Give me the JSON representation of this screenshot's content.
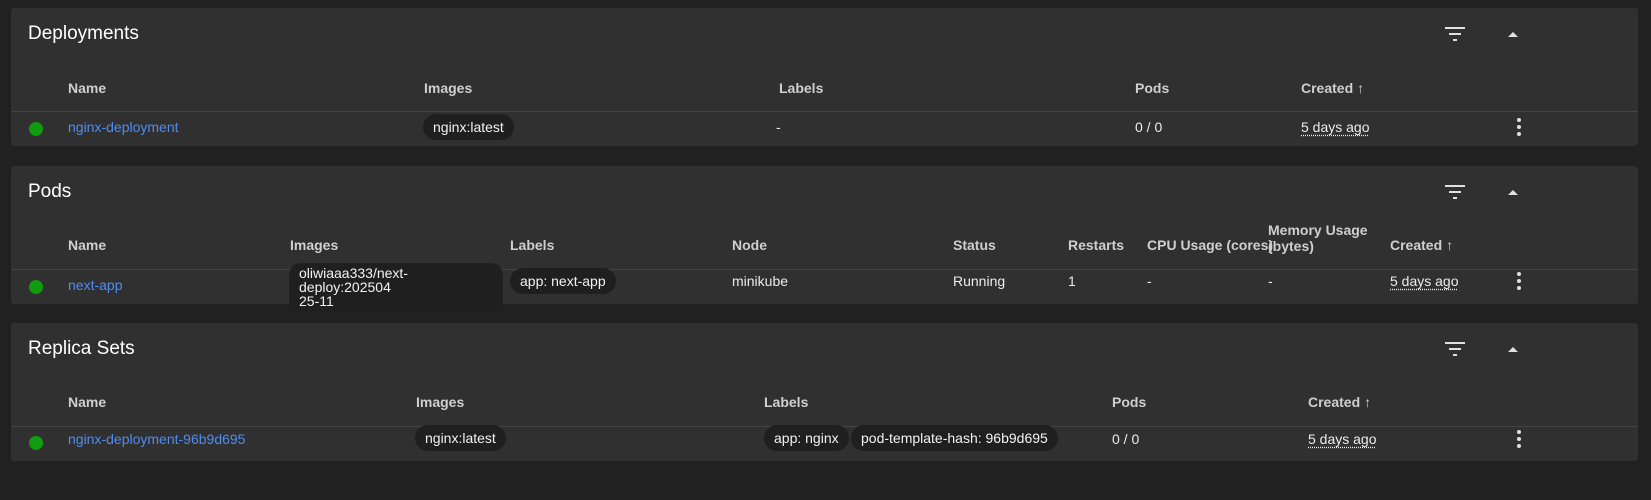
{
  "deployments": {
    "title": "Deployments",
    "columns": [
      "Name",
      "Images",
      "Labels",
      "Pods",
      "Created"
    ],
    "sort_indicator": "↑",
    "rows": [
      {
        "name": "nginx-deployment",
        "images": [
          "nginx:latest"
        ],
        "labels": "-",
        "pods": "0 / 0",
        "created": "5 days ago"
      }
    ]
  },
  "pods": {
    "title": "Pods",
    "columns": [
      "Name",
      "Images",
      "Labels",
      "Node",
      "Status",
      "Restarts",
      "CPU Usage (cores)",
      "Memory Usage",
      "(bytes)",
      "Created"
    ],
    "sort_indicator": "↑",
    "rows": [
      {
        "name": "next-app",
        "image_line1": "oliwiaaa333/next-deploy:202504",
        "image_line2": "25-11",
        "labels": [
          "app: next-app"
        ],
        "node": "minikube",
        "status": "Running",
        "restarts": "1",
        "cpu": "-",
        "memory": "-",
        "created": "5 days ago"
      }
    ]
  },
  "replica_sets": {
    "title": "Replica Sets",
    "columns": [
      "Name",
      "Images",
      "Labels",
      "Pods",
      "Created"
    ],
    "sort_indicator": "↑",
    "rows": [
      {
        "name": "nginx-deployment-96b9d695",
        "images": [
          "nginx:latest"
        ],
        "labels": [
          "app: nginx",
          "pod-template-hash: 96b9d695"
        ],
        "pods": "0 / 0",
        "created": "5 days ago"
      }
    ]
  },
  "icons": {
    "filter": "filter-icon",
    "collapse": "chevron-up-icon",
    "more": "more-vert-icon",
    "status": "status-ok-icon"
  },
  "colors": {
    "background": "#212121",
    "card": "#303030",
    "link": "#4d8df5",
    "status_ok": "#0f9d0f",
    "chip": "#1f1f1f"
  }
}
